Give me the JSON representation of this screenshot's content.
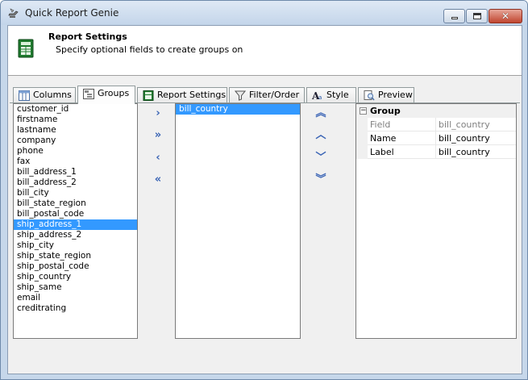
{
  "window": {
    "title": "Quick Report Genie",
    "close_glyph": "✕"
  },
  "header": {
    "title": "Report Settings",
    "subtitle": "Specify optional fields to create groups on"
  },
  "tabs": [
    {
      "label": "Columns",
      "icon": "columns-icon"
    },
    {
      "label": "Groups",
      "icon": "groups-icon"
    },
    {
      "label": "Report Settings",
      "icon": "report-settings-icon"
    },
    {
      "label": "Filter/Order",
      "icon": "filter-icon"
    },
    {
      "label": "Style",
      "icon": "style-icon"
    },
    {
      "label": "Preview",
      "icon": "preview-icon"
    }
  ],
  "active_tab": "Groups",
  "available_fields": [
    "customer_id",
    "firstname",
    "lastname",
    "company",
    "phone",
    "fax",
    "bill_address_1",
    "bill_address_2",
    "bill_city",
    "bill_state_region",
    "bill_postal_code",
    "ship_address_1",
    "ship_address_2",
    "ship_city",
    "ship_state_region",
    "ship_postal_code",
    "ship_country",
    "ship_same",
    "email",
    "creditrating"
  ],
  "available_selected": "ship_address_1",
  "group_fields": [
    "bill_country"
  ],
  "group_selected": "bill_country",
  "move_buttons": {
    "add": "›",
    "add_all": "»",
    "remove": "‹",
    "remove_all": "«"
  },
  "order_buttons": {
    "top": "︽",
    "up": "︿",
    "down": "﹀",
    "bottom": "︾"
  },
  "properties": {
    "category": "Group",
    "toggle": "−",
    "rows": [
      {
        "name": "Field",
        "value": "bill_country",
        "readonly": true
      },
      {
        "name": "Name",
        "value": "bill_country",
        "readonly": false
      },
      {
        "name": "Label",
        "value": "bill_country",
        "readonly": false
      }
    ]
  }
}
